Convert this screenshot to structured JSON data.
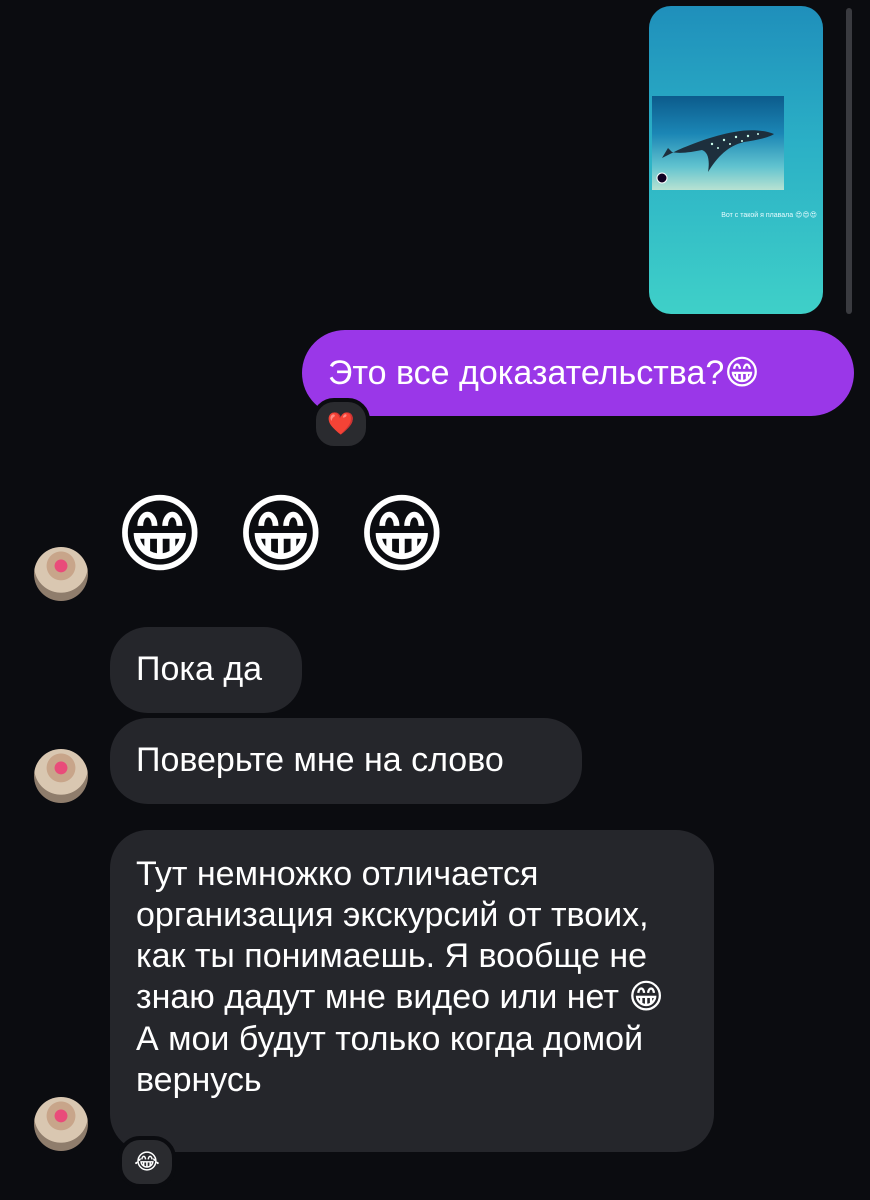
{
  "story": {
    "caption": "Вот с такой я плавала 😍😍😍"
  },
  "outgoing": {
    "text": "Это все доказательства?😁",
    "reaction": "❤️"
  },
  "incoming": {
    "emoji_message": [
      "😁",
      "😁",
      "😁"
    ],
    "messages": [
      "Пока да",
      "Поверьте мне на слово",
      "Тут немножко отличается организация экскурсий от твоих,  как ты понимаешь. Я вообще не знаю дадут мне видео или нет 😁 А мои будут только когда домой вернусь"
    ],
    "last_reaction": "😂"
  }
}
